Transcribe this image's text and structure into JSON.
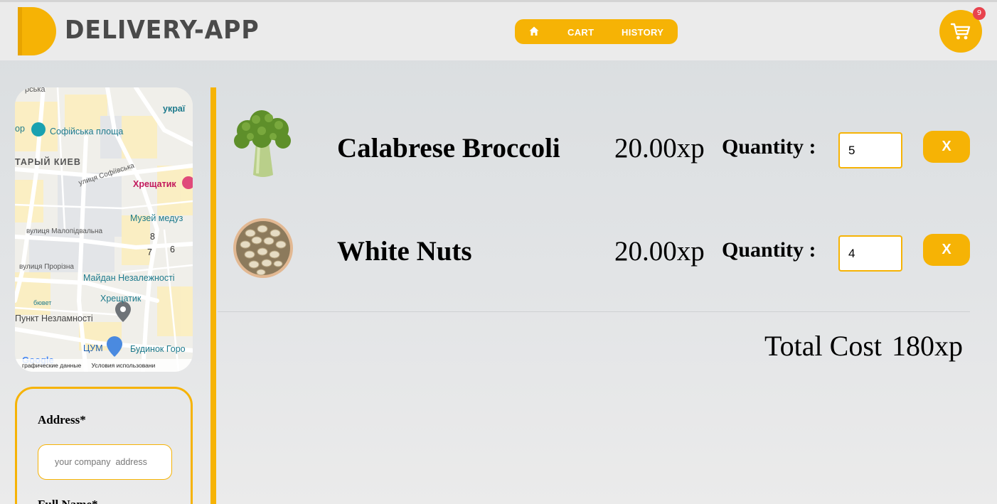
{
  "header": {
    "logo_text": "DELIVERY-APP",
    "nav": {
      "home_icon": "home-icon",
      "cart_label": "CART",
      "history_label": "HISTORY"
    },
    "cart_count": "9",
    "accent_color": "#f6b305"
  },
  "map": {
    "labels": [
      "рська",
      "украї",
      "ор",
      "Софійська площа",
      "ТАРЫЙ КИЕВ",
      "улиця Софіївська",
      "Хрещатик",
      "Музей медуз",
      "вулиця Малопідвальна",
      "8",
      "7",
      "6",
      "вулиця Прорізна",
      "Майдан Незалежності",
      "Хрещатик",
      "бювет",
      "Пункт Незламності",
      "ЦУМ",
      "Будинок Горо"
    ],
    "footer_data": "графические данные",
    "footer_terms": "Условия использовани",
    "google": "Google"
  },
  "form": {
    "address_label": "Address*",
    "address_placeholder": "your company  address",
    "fullname_label": "Full Name*"
  },
  "cart": {
    "quantity_label": "Quantity :",
    "remove_label": "X",
    "items": [
      {
        "name": "Calabrese Broccoli",
        "price": "20.00xp",
        "quantity": "5",
        "icon": "broccoli-image"
      },
      {
        "name": "White Nuts",
        "price": "20.00xp",
        "quantity": "4",
        "icon": "nuts-image"
      }
    ],
    "total_label": "Total Cost",
    "total_value": "180xp"
  }
}
